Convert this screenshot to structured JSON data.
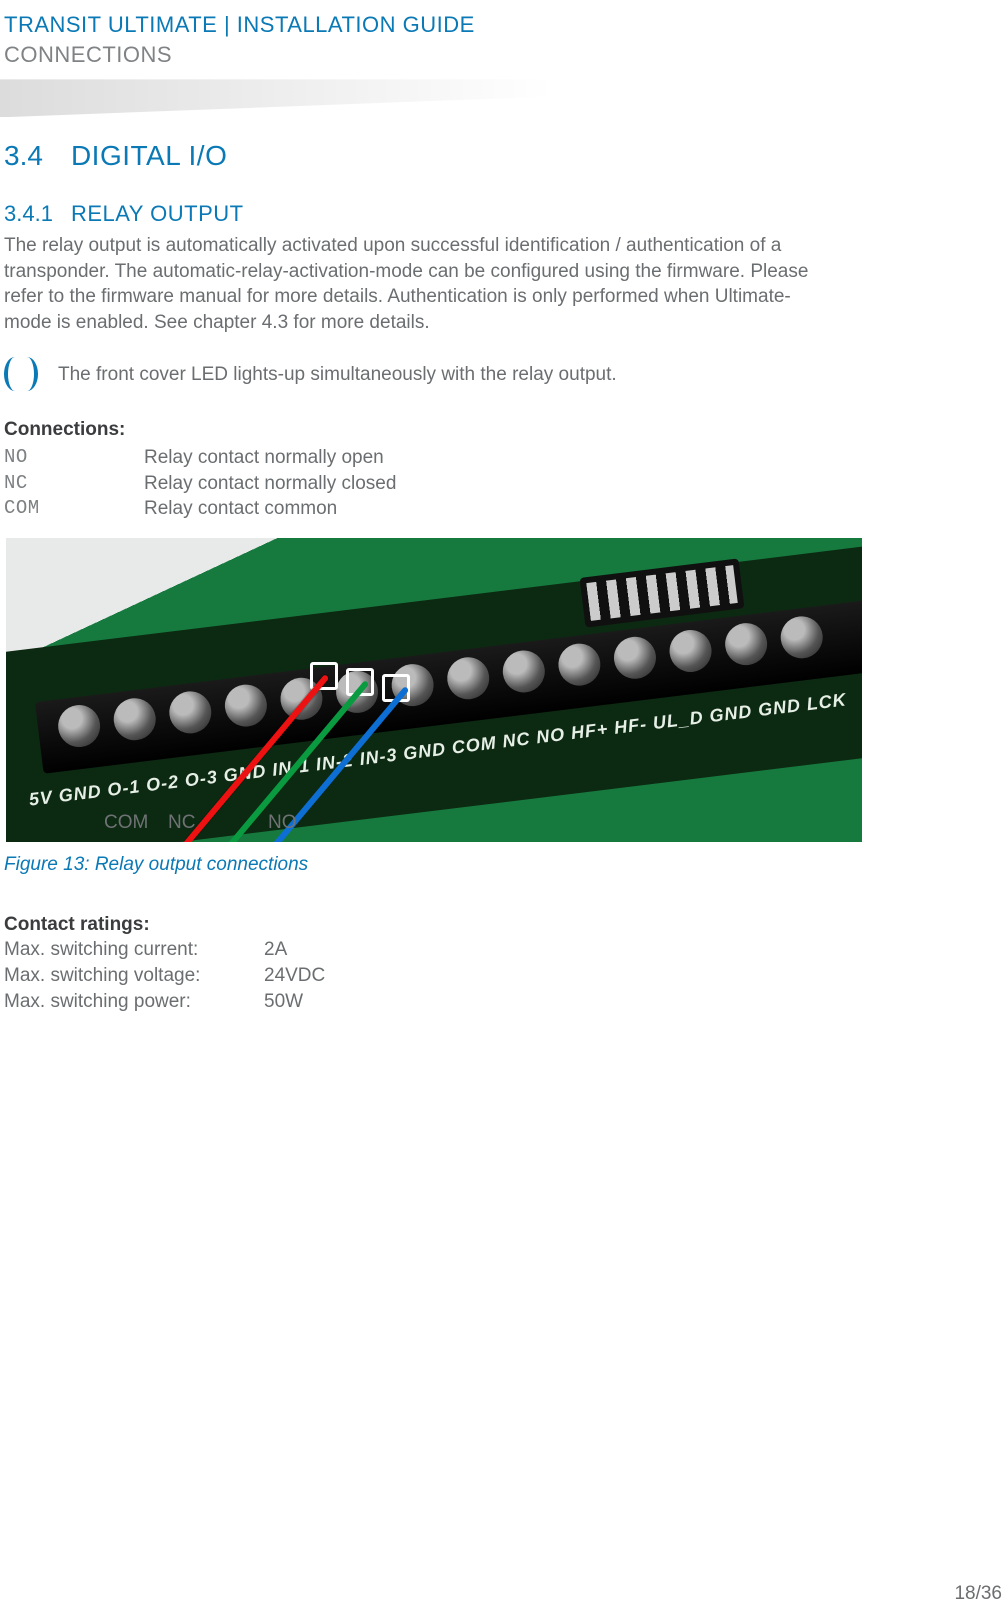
{
  "header": {
    "title": "TRANSIT ULTIMATE | INSTALLATION GUIDE",
    "subtitle": "CONNECTIONS"
  },
  "section": {
    "number": "3.4",
    "title": "DIGITAL I/O"
  },
  "subsection": {
    "number": "3.4.1",
    "title": "RELAY OUTPUT"
  },
  "paragraph": "The relay output is automatically activated upon successful identification / authentication of a transponder. The automatic-relay-activation-mode can be configured using the firmware. Please refer to the firmware manual for more details. Authentication is only performed when Ultimate-mode is enabled. See chapter 4.3 for more details.",
  "note": "The front cover LED lights-up simultaneously with the relay output.",
  "connections": {
    "heading": "Connections:",
    "rows": [
      {
        "key": "NO",
        "val": "Relay contact normally open"
      },
      {
        "key": "NC",
        "val": "Relay contact normally closed"
      },
      {
        "key": "COM",
        "val": "Relay contact common"
      }
    ]
  },
  "figure": {
    "caption": "Figure 13: Relay output connections",
    "labels": {
      "com": "COM",
      "nc": "NC",
      "no": "NO"
    },
    "silk": "5V  GND  O-1  O-2  O-3  GND  IN-1  IN-2  IN-3  GND  COM  NC  NO  HF+  HF-  UL_D GND  GND  LCK"
  },
  "ratings": {
    "heading": "Contact ratings:",
    "rows": [
      {
        "key": "Max. switching current:",
        "val": "2A"
      },
      {
        "key": "Max. switching voltage:",
        "val": "24VDC"
      },
      {
        "key": "Max. switching power:",
        "val": "50W"
      }
    ]
  },
  "page_number": "18/36"
}
